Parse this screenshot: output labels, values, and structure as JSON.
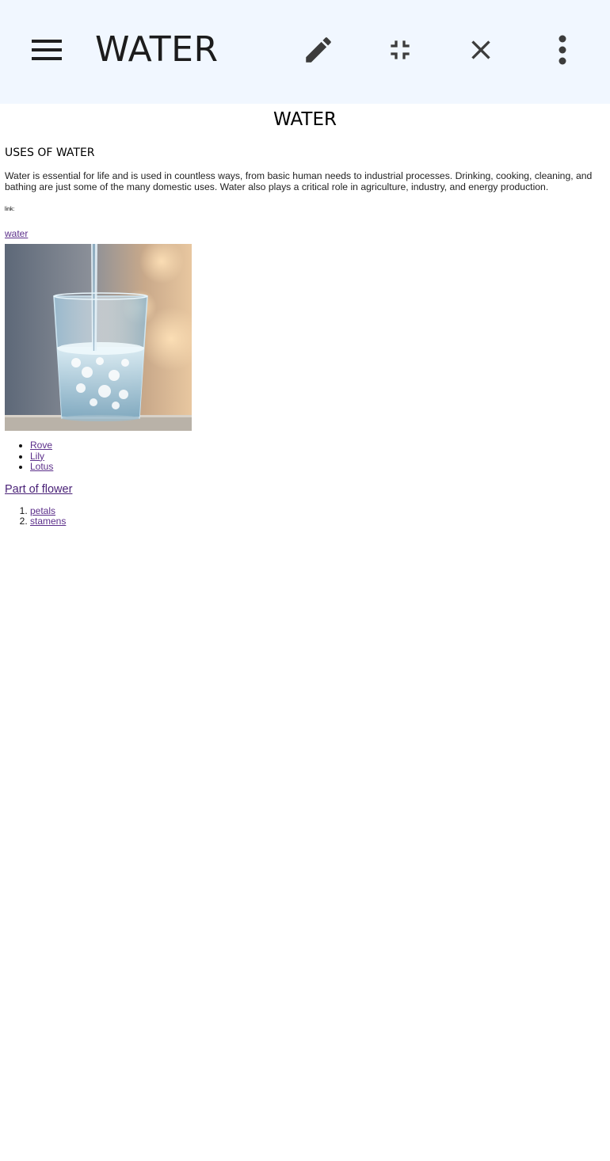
{
  "toolbar": {
    "title": "WATER",
    "icons": [
      "menu-icon",
      "edit-icon",
      "fullscreen-exit-icon",
      "close-icon",
      "more-vert-icon"
    ],
    "background": "#f1f7ff"
  },
  "document": {
    "title": "WATER",
    "section_heading": "USES OF WATER",
    "paragraph": "Water is essential for life and is used in countless ways, from basic human needs to industrial processes. Drinking, cooking, cleaning, and bathing are just some of the many domestic uses. Water also plays a critical role in agriculture, industry, and energy production.",
    "link_label": "link:",
    "link_text": "water",
    "flowers": [
      "Rove",
      "Lily",
      "Lotus"
    ],
    "flower_heading": "Part of flower",
    "flower_parts": [
      "petals",
      "stamens"
    ],
    "link_color": "#5b2e8a"
  }
}
